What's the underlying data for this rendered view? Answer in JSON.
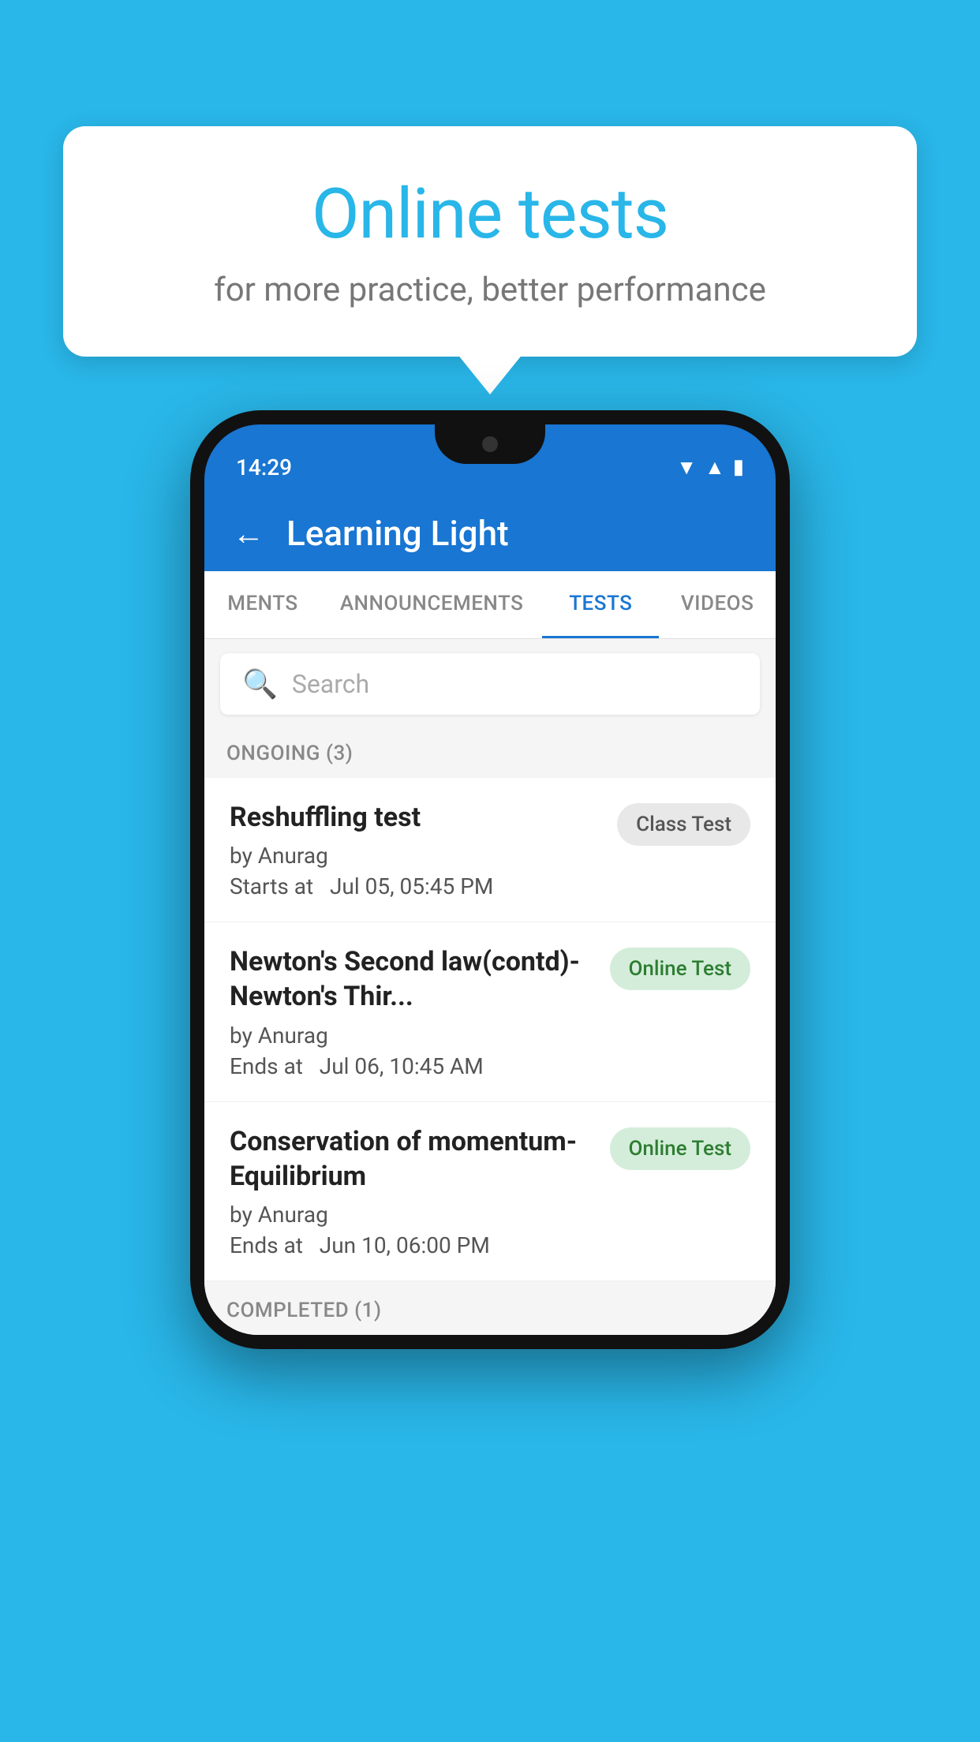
{
  "background_color": "#29b6e8",
  "bubble": {
    "title": "Online tests",
    "subtitle": "for more practice, better performance"
  },
  "status_bar": {
    "time": "14:29",
    "icons": [
      "▼",
      "▲",
      "▮"
    ]
  },
  "app_header": {
    "back_label": "←",
    "title": "Learning Light"
  },
  "tabs": [
    {
      "label": "MENTS",
      "active": false
    },
    {
      "label": "ANNOUNCEMENTS",
      "active": false
    },
    {
      "label": "TESTS",
      "active": true
    },
    {
      "label": "VIDEOS",
      "active": false
    }
  ],
  "search": {
    "placeholder": "Search"
  },
  "sections": [
    {
      "header": "ONGOING (3)",
      "items": [
        {
          "title": "Reshuffling test",
          "author": "by Anurag",
          "date": "Starts at  Jul 05, 05:45 PM",
          "badge": "Class Test",
          "badge_type": "class"
        },
        {
          "title": "Newton's Second law(contd)-Newton's Thir...",
          "author": "by Anurag",
          "date": "Ends at  Jul 06, 10:45 AM",
          "badge": "Online Test",
          "badge_type": "online"
        },
        {
          "title": "Conservation of momentum-Equilibrium",
          "author": "by Anurag",
          "date": "Ends at  Jun 10, 06:00 PM",
          "badge": "Online Test",
          "badge_type": "online"
        }
      ]
    }
  ],
  "completed_header": "COMPLETED (1)"
}
